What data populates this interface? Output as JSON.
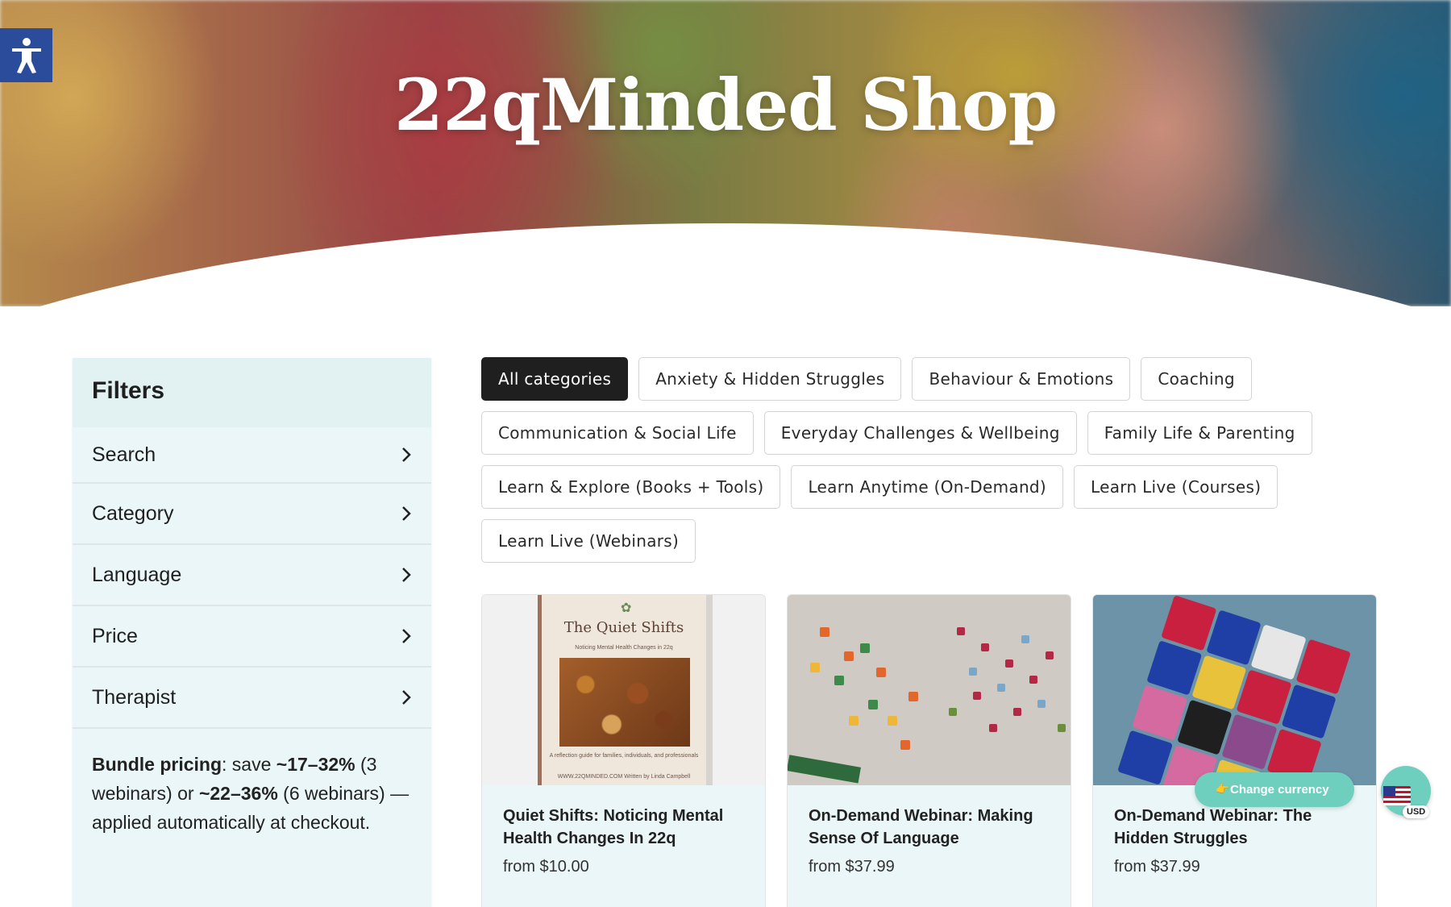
{
  "hero": {
    "title": "22qMinded Shop"
  },
  "accessibility": {
    "icon": "accessibility-icon"
  },
  "filters": {
    "heading": "Filters",
    "items": [
      {
        "label": "Search"
      },
      {
        "label": "Category"
      },
      {
        "label": "Language"
      },
      {
        "label": "Price"
      },
      {
        "label": "Therapist"
      }
    ],
    "bundle": {
      "lead": "Bundle pricing",
      "t1": ": save ",
      "b1": "~17–32%",
      "t2": " (3 webinars) or ",
      "b2": "~22–36%",
      "t3": " (6 webinars) — applied automatically at checkout."
    }
  },
  "categories": [
    {
      "label": "All categories",
      "active": true
    },
    {
      "label": "Anxiety & Hidden Struggles"
    },
    {
      "label": "Behaviour & Emotions"
    },
    {
      "label": "Coaching"
    },
    {
      "label": "Communication & Social Life"
    },
    {
      "label": "Everyday Challenges & Wellbeing"
    },
    {
      "label": "Family Life & Parenting"
    },
    {
      "label": "Learn & Explore (Books + Tools)"
    },
    {
      "label": "Learn Anytime (On-Demand)"
    },
    {
      "label": "Learn Live (Courses)"
    },
    {
      "label": "Learn Live (Webinars)"
    }
  ],
  "products": [
    {
      "title": "Quiet Shifts: Noticing Mental Health Changes In 22q",
      "price": "from $10.00",
      "cover": {
        "title": "The Quiet Shifts",
        "subtitle": "Noticing Mental Health Changes in 22q",
        "tagline": "A reflection guide for families, individuals, and professionals",
        "footer": "WWW.22QMINDED.COM   Written by Linda Campbell"
      }
    },
    {
      "title": "On-Demand Webinar: Making Sense Of Language",
      "price": "from $37.99"
    },
    {
      "title": "On-Demand Webinar: The Hidden Struggles",
      "price": "from $37.99"
    }
  ],
  "currency": {
    "button_label": "Change currency",
    "code": "USD"
  },
  "colors": {
    "active_pill": "#1f1f1f",
    "sidebar_bg": "#eaf6f7",
    "currency": "#6fcfbf",
    "a11y": "#2b4c9b"
  }
}
